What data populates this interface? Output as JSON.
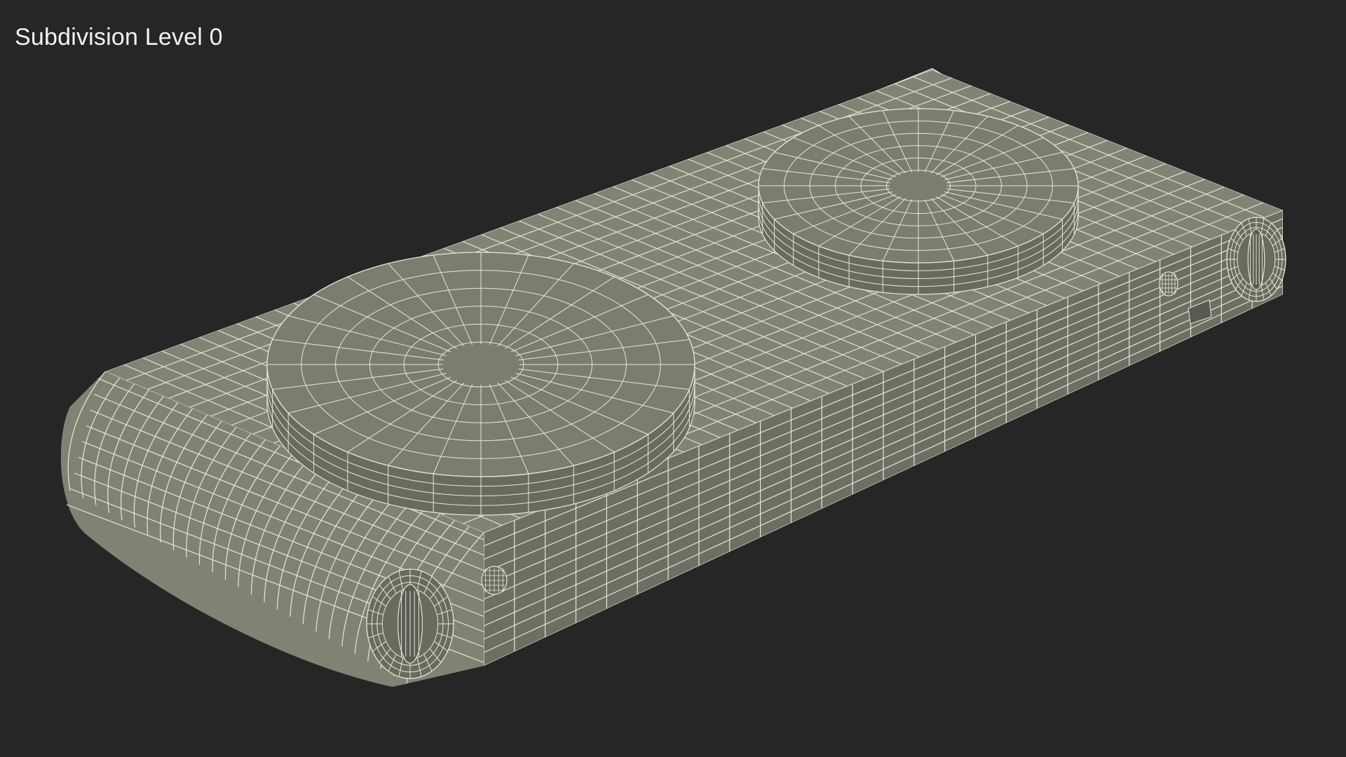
{
  "caption": "Subdivision Level 0",
  "colors": {
    "background": "#262626",
    "surface": "#7e7e70",
    "surface_light": "#8b8b7d",
    "surface_dark": "#5f5f54",
    "wire": "#e6e6da"
  },
  "subject": "electric-double-hot-plate-wireframe"
}
